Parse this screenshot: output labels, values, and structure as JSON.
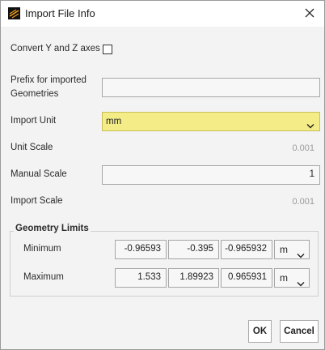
{
  "window": {
    "title": "Import File Info",
    "app_icon": "app-logo-icon",
    "close_icon": "close-icon"
  },
  "form": {
    "convert_axes_label": "Convert Y and Z axes",
    "convert_axes_checked": false,
    "prefix_label_line1": "Prefix for imported",
    "prefix_label_line2": "Geometries",
    "prefix_value": "",
    "import_unit_label": "Import Unit",
    "import_unit_value": "mm",
    "import_unit_highlight": "#f4ec86",
    "unit_scale_label": "Unit Scale",
    "unit_scale_value": "0.001",
    "manual_scale_label": "Manual Scale",
    "manual_scale_value": "1",
    "import_scale_label": "Import Scale",
    "import_scale_value": "0.001"
  },
  "geometry_limits": {
    "title": "Geometry Limits",
    "minimum_label": "Minimum",
    "minimum": [
      "-0.96593",
      "-0.395",
      "-0.965932"
    ],
    "minimum_unit": "m",
    "maximum_label": "Maximum",
    "maximum": [
      "1.533",
      "1.89923",
      "0.965931"
    ],
    "maximum_unit": "m"
  },
  "buttons": {
    "ok": "OK",
    "cancel": "Cancel"
  }
}
